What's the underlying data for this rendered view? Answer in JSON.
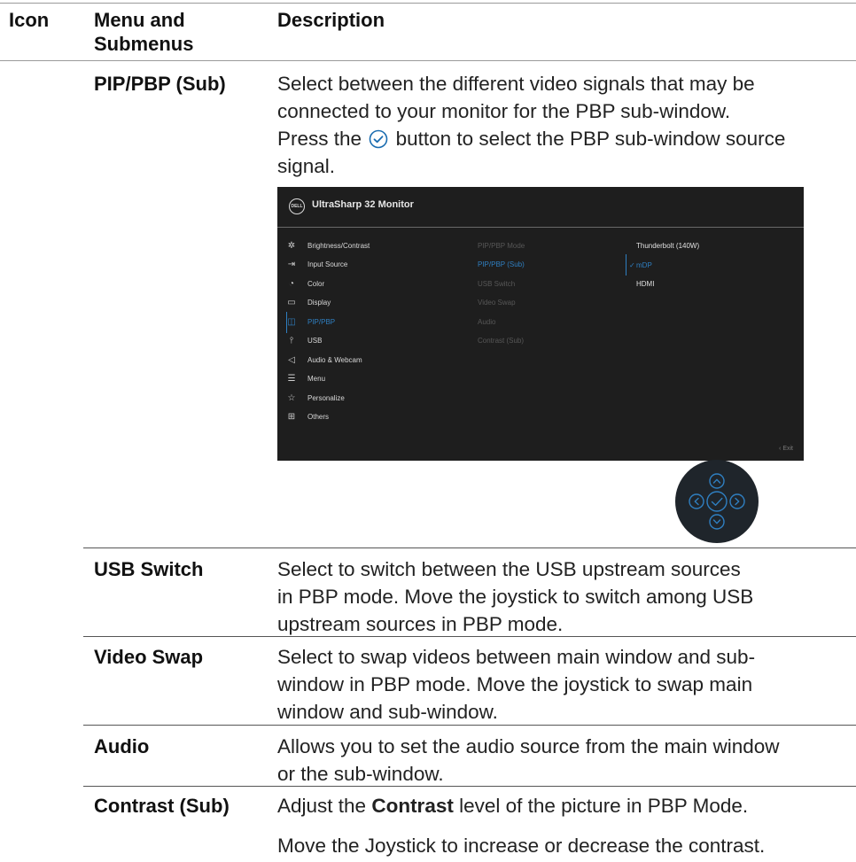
{
  "header": {
    "icon": "Icon",
    "menu_line1": "Menu and",
    "menu_line2": "Submenus",
    "description": "Description"
  },
  "rows": [
    {
      "term": "PIP/PBP (Sub)",
      "desc_line1": "Select between the different video signals that may be",
      "desc_line2": "connected to your monitor for the PBP sub-window.",
      "desc_line3a": "Press the",
      "desc_line3b": "button to select the PBP sub-window source",
      "desc_line4": "signal."
    },
    {
      "term": "USB Switch",
      "desc_line1": "Select to switch between the USB upstream sources",
      "desc_line2": "in PBP mode. Move the joystick to switch among USB",
      "desc_line3": "upstream sources in PBP mode."
    },
    {
      "term": "Video Swap",
      "desc_line1": "Select to swap videos between main window and sub-",
      "desc_line2": "window in PBP mode. Move the joystick to swap main",
      "desc_line3": "window and sub-window."
    },
    {
      "term": "Audio",
      "desc_line1": "Allows you to set the audio source from the main window",
      "desc_line2": "or  the sub-window."
    },
    {
      "term": "Contrast (Sub)",
      "desc_pre": "Adjust the ",
      "desc_bold": "Contrast",
      "desc_post": " level of the picture in PBP Mode.",
      "desc_para2": "Move the Joystick to increase or decrease the contrast."
    }
  ],
  "osd": {
    "logo": "DELL",
    "title": "UltraSharp 32 Monitor",
    "menu": [
      {
        "label": "Brightness/Contrast",
        "icon": "brightness-icon"
      },
      {
        "label": "Input Source",
        "icon": "input-source-icon"
      },
      {
        "label": "Color",
        "icon": "color-icon"
      },
      {
        "label": "Display",
        "icon": "display-icon"
      },
      {
        "label": "PIP/PBP",
        "icon": "pip-pbp-icon"
      },
      {
        "label": "USB",
        "icon": "usb-icon"
      },
      {
        "label": "Audio & Webcam",
        "icon": "audio-icon"
      },
      {
        "label": "Menu",
        "icon": "menu-icon"
      },
      {
        "label": "Personalize",
        "icon": "star-icon"
      },
      {
        "label": "Others",
        "icon": "others-icon"
      }
    ],
    "active_menu": "PIP/PBP",
    "submenu": [
      "PIP/PBP Mode",
      "PIP/PBP (Sub)",
      "USB Switch",
      "Video Swap",
      "Audio",
      "Contrast (Sub)"
    ],
    "active_submenu": "PIP/PBP (Sub)",
    "options": [
      "Thunderbolt (140W)",
      "mDP",
      "HDMI"
    ],
    "selected_option": "mDP",
    "exit": "Exit",
    "accent_color": "#2f7fc1"
  }
}
